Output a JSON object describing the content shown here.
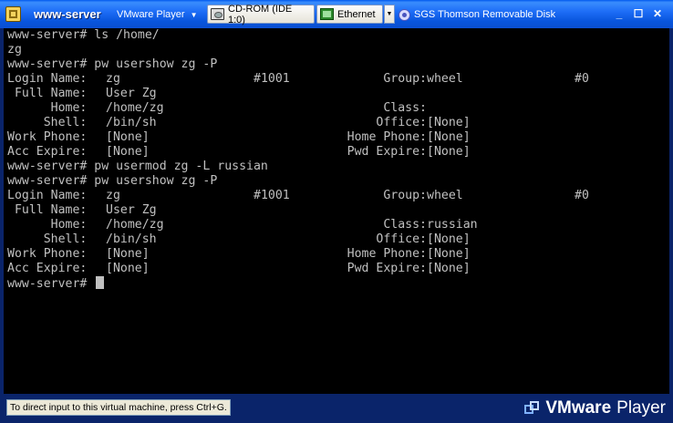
{
  "window": {
    "title": "www-server",
    "menu_label": "VMware Player",
    "menu_arrow": "▼",
    "devices": {
      "cdrom": "CD-ROM (IDE 1:0)",
      "ethernet": "Ethernet",
      "more_arrow": "▼",
      "usb": "SGS Thomson Removable Disk"
    },
    "controls": {
      "minimize": "_",
      "restore": "☐",
      "close": "✕"
    }
  },
  "console": {
    "lines": [
      {
        "prompt": "www-server#",
        "cmd": " ls /home/"
      },
      {
        "text": "zg"
      },
      {
        "prompt": "www-server#",
        "cmd": " pw usershow zg -P"
      },
      {
        "l": "Login Name:",
        "v": "zg",
        "m": "#1001",
        "rl": "Group:",
        "rv": "wheel",
        "e": "#0"
      },
      {
        "l": " Full Name:",
        "v": "User Zg"
      },
      {
        "l": "      Home:",
        "v": "/home/zg",
        "rl": "Class:",
        "rv": ""
      },
      {
        "l": "     Shell:",
        "v": "/bin/sh",
        "rl": "Office:",
        "rv": "[None]"
      },
      {
        "l": "Work Phone:",
        "v": "[None]",
        "rl": "Home Phone:",
        "rv": "[None]"
      },
      {
        "l": "Acc Expire:",
        "v": "[None]",
        "rl": "Pwd Expire:",
        "rv": "[None]"
      },
      {
        "prompt": "www-server#",
        "cmd": " pw usermod zg -L russian"
      },
      {
        "prompt": "www-server#",
        "cmd": " pw usershow zg -P"
      },
      {
        "l": "Login Name:",
        "v": "zg",
        "m": "#1001",
        "rl": "Group:",
        "rv": "wheel",
        "e": "#0"
      },
      {
        "l": " Full Name:",
        "v": "User Zg"
      },
      {
        "l": "      Home:",
        "v": "/home/zg",
        "rl": "Class:",
        "rv": "russian"
      },
      {
        "l": "     Shell:",
        "v": "/bin/sh",
        "rl": "Office:",
        "rv": "[None]"
      },
      {
        "l": "Work Phone:",
        "v": "[None]",
        "rl": "Home Phone:",
        "rv": "[None]"
      },
      {
        "l": "Acc Expire:",
        "v": "[None]",
        "rl": "Pwd Expire:",
        "rv": "[None]"
      },
      {
        "prompt": "www-server#",
        "cmd": "",
        "cursor": true
      }
    ]
  },
  "status": {
    "hint": "To direct input to this virtual machine, press Ctrl+G.",
    "brand_bold": "VMware",
    "brand_rest": "Player"
  }
}
